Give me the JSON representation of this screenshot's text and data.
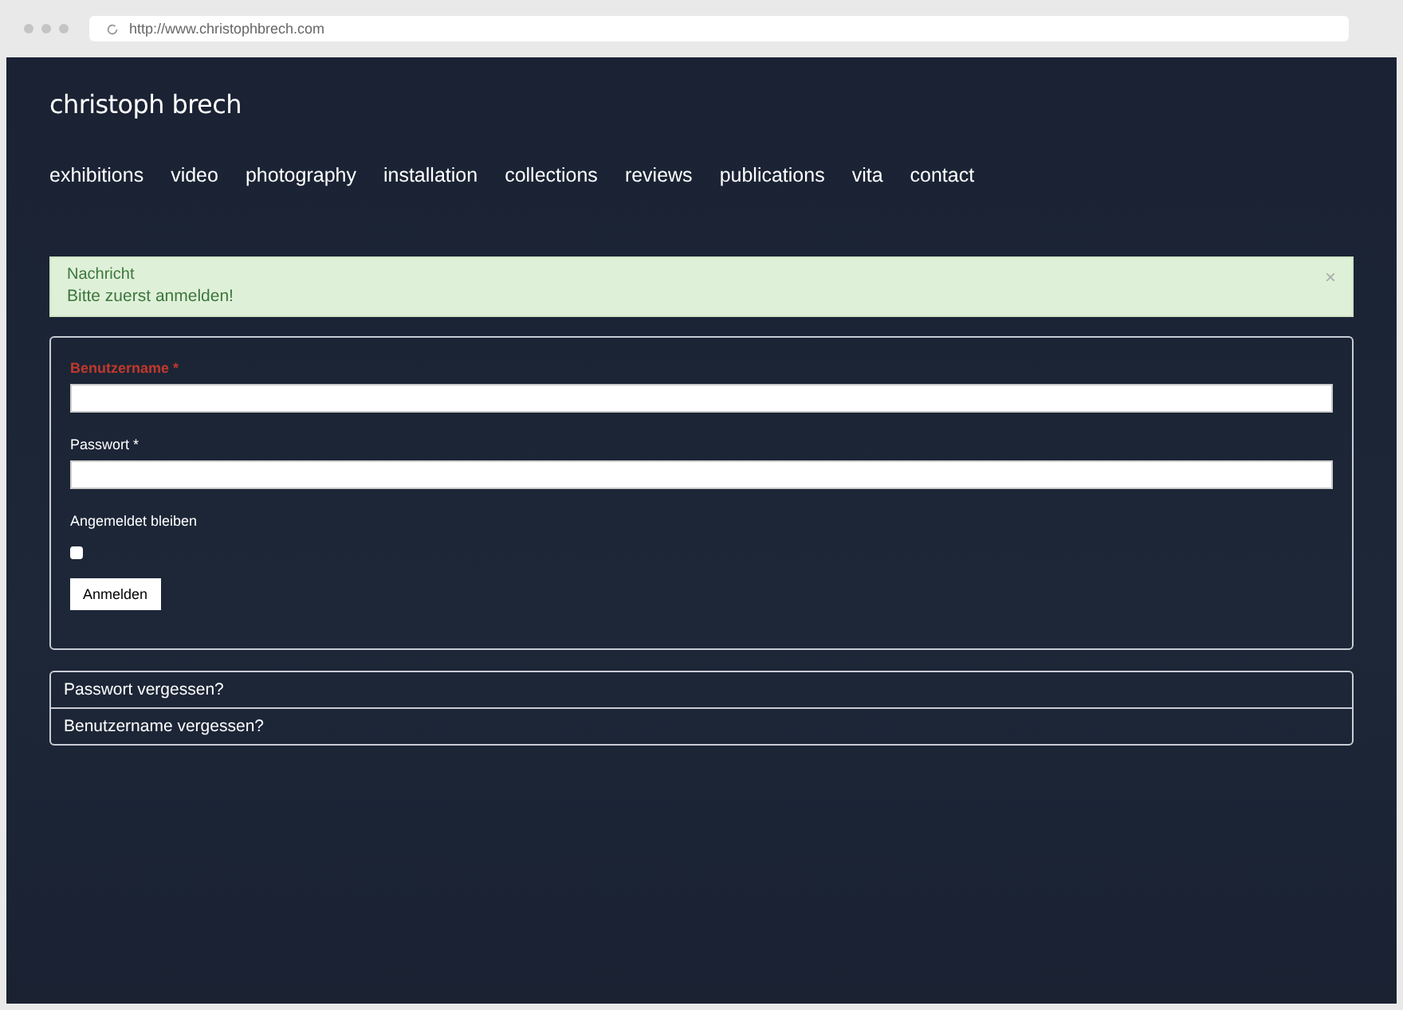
{
  "browser": {
    "url": "http://www.christophbrech.com"
  },
  "site": {
    "title": "christoph brech"
  },
  "nav": [
    {
      "label": "exhibitions"
    },
    {
      "label": "video"
    },
    {
      "label": "photography"
    },
    {
      "label": "installation"
    },
    {
      "label": "collections"
    },
    {
      "label": "reviews"
    },
    {
      "label": "publications"
    },
    {
      "label": "vita"
    },
    {
      "label": "contact"
    }
  ],
  "alert": {
    "heading": "Nachricht",
    "message": "Bitte zuerst anmelden!",
    "close": "×"
  },
  "form": {
    "fields": [
      {
        "label": "Benutzername *",
        "error": true
      },
      {
        "label": "Passwort *",
        "error": false
      }
    ],
    "remember": {
      "label": "Angemeldet bleiben",
      "checked": false
    },
    "submit": "Anmelden"
  },
  "links": [
    {
      "label": "Passwort vergessen?"
    },
    {
      "label": "Benutzername vergessen?"
    }
  ]
}
